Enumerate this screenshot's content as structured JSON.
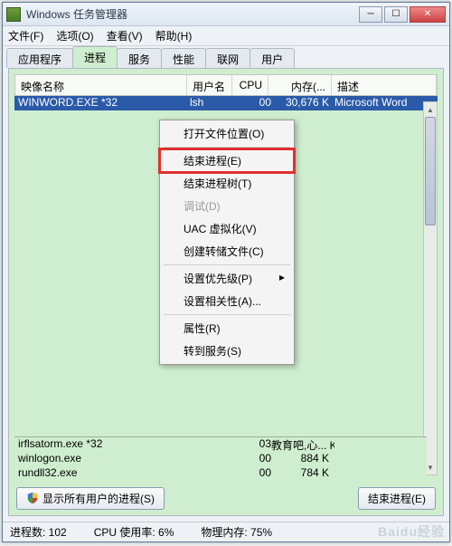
{
  "window": {
    "title": "Windows 任务管理器"
  },
  "menubar": {
    "file": "文件(F)",
    "options": "选项(O)",
    "view": "查看(V)",
    "help": "帮助(H)"
  },
  "tabs": {
    "apps": "应用程序",
    "processes": "进程",
    "services": "服务",
    "performance": "性能",
    "network": "联网",
    "users": "用户"
  },
  "columns": {
    "name": "映像名称",
    "user": "用户名",
    "cpu": "CPU",
    "mem": "内存(...",
    "desc": "描述"
  },
  "processes": {
    "selected": {
      "name": "WINWORD.EXE *32",
      "user": "lsh",
      "cpu": "00",
      "mem": "30,676 K",
      "desc": "Microsoft Word"
    },
    "bottom": [
      {
        "name": "irflsatorm.exe *32",
        "user": "",
        "cpu": "03",
        "mem": "教育吧,心... K",
        "desc": ""
      },
      {
        "name": "winlogon.exe",
        "user": "",
        "cpu": "00",
        "mem": "884 K",
        "desc": ""
      },
      {
        "name": "rundll32.exe",
        "user": "",
        "cpu": "00",
        "mem": "784 K",
        "desc": ""
      }
    ]
  },
  "context_menu": {
    "open_location": "打开文件位置(O)",
    "end_process": "结束进程(E)",
    "end_tree": "结束进程树(T)",
    "debug": "调试(D)",
    "uac": "UAC 虚拟化(V)",
    "create_dump": "创建转储文件(C)",
    "priority": "设置优先级(P)",
    "affinity": "设置相关性(A)...",
    "properties": "属性(R)",
    "goto_service": "转到服务(S)"
  },
  "buttons": {
    "show_all": "显示所有用户的进程(S)",
    "end_process": "结束进程(E)"
  },
  "status": {
    "count": "进程数: 102",
    "cpu": "CPU 使用率: 6%",
    "mem": "物理内存: 75%"
  },
  "watermark": "Baidu经验"
}
